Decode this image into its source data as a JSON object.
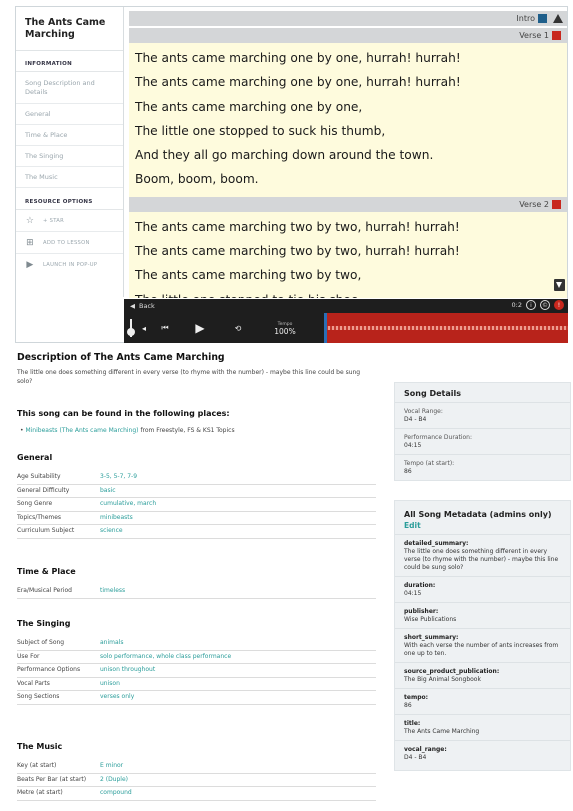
{
  "sidebar": {
    "title": "The Ants Came Marching",
    "information_heading": "INFORMATION",
    "information_items": [
      "Song Description and Details",
      "General",
      "Time & Place",
      "The Singing",
      "The Music"
    ],
    "resource_heading": "RESOURCE OPTIONS",
    "resource_options": [
      {
        "label": "+ STAR",
        "icon": "star-icon"
      },
      {
        "label": "ADD TO LESSON",
        "icon": "add-icon"
      },
      {
        "label": "LAUNCH IN POP-UP",
        "icon": "play-icon"
      }
    ]
  },
  "lyrics": {
    "intro_label": "Intro",
    "verses": [
      {
        "label": "Verse 1",
        "lines": [
          "The ants came marching one by one, hurrah! hurrah!",
          "The ants came marching one by one, hurrah! hurrah!",
          "The ants came marching one by one,",
          "The little one stopped to suck his thumb,",
          "And they all go marching down around the town.",
          "Boom, boom, boom."
        ]
      },
      {
        "label": "Verse 2",
        "lines": [
          "The ants came marching two by two, hurrah! hurrah!",
          "The ants came marching two by two, hurrah! hurrah!",
          "The ants came marching two by two,",
          "The little one stopped to tie his shoe,"
        ]
      }
    ],
    "colors": {
      "intro": "#1f5f8b",
      "verse": "#c8281e"
    }
  },
  "player": {
    "back_label": "Back",
    "tempo_label": "Tempo",
    "tempo_value": "100%",
    "counter": "0:2"
  },
  "description": {
    "heading": "Description of The Ants Came Marching",
    "text": "The little one does something different in every verse (to rhyme with the number) - maybe this line could be sung solo?",
    "found_heading": "This song can be found in the following places:",
    "found_link1": "Minibeasts",
    "found_link2": "(The Ants came Marching)",
    "found_suffix": "from Freestyle, FS & KS1 Topics"
  },
  "general": {
    "heading": "General",
    "rows": [
      {
        "k": "Age Suitability",
        "v": "3-5, 5-7, 7-9"
      },
      {
        "k": "General Difficulty",
        "v": "basic"
      },
      {
        "k": "Song Genre",
        "v": "cumulative, march"
      },
      {
        "k": "Topics/Themes",
        "v": "minibeasts"
      },
      {
        "k": "Curriculum Subject",
        "v": "science"
      }
    ]
  },
  "time_place": {
    "heading": "Time & Place",
    "rows": [
      {
        "k": "Era/Musical Period",
        "v": "timeless"
      }
    ]
  },
  "singing": {
    "heading": "The Singing",
    "rows": [
      {
        "k": "Subject of Song",
        "v": "animals"
      },
      {
        "k": "Use For",
        "v": "solo performance, whole class performance"
      },
      {
        "k": "Performance Options",
        "v": "unison throughout"
      },
      {
        "k": "Vocal Parts",
        "v": "unison"
      },
      {
        "k": "Song Sections",
        "v": "verses only"
      }
    ]
  },
  "music": {
    "heading": "The Music",
    "rows": [
      {
        "k": "Key (at start)",
        "v": "E minor"
      },
      {
        "k": "Beats Per Bar (at start)",
        "v": "2 (Duple)"
      },
      {
        "k": "Metre (at start)",
        "v": "compound"
      }
    ]
  },
  "song_details": {
    "heading": "Song Details",
    "rows": [
      {
        "k": "Vocal Range:",
        "v": "D4 - B4"
      },
      {
        "k": "Performance Duration:",
        "v": "04:15"
      },
      {
        "k": "Tempo (at start):",
        "v": "86"
      }
    ]
  },
  "metadata": {
    "heading": "All Song Metadata (admins only)",
    "edit_label": "Edit",
    "rows": [
      {
        "k": "detailed_summary:",
        "v": "The little one does something different in every verse (to rhyme with the number) - maybe this line could be sung solo?"
      },
      {
        "k": "duration:",
        "v": "04:15"
      },
      {
        "k": "publisher:",
        "v": "Wise Publications"
      },
      {
        "k": "short_summary:",
        "v": "With each verse the number of ants increases from one up to ten."
      },
      {
        "k": "source_product_publication:",
        "v": "The Big Animal Songbook"
      },
      {
        "k": "tempo:",
        "v": "86"
      },
      {
        "k": "title:",
        "v": "The Ants Came Marching"
      },
      {
        "k": "vocal_range:",
        "v": "D4 - B4"
      }
    ]
  }
}
